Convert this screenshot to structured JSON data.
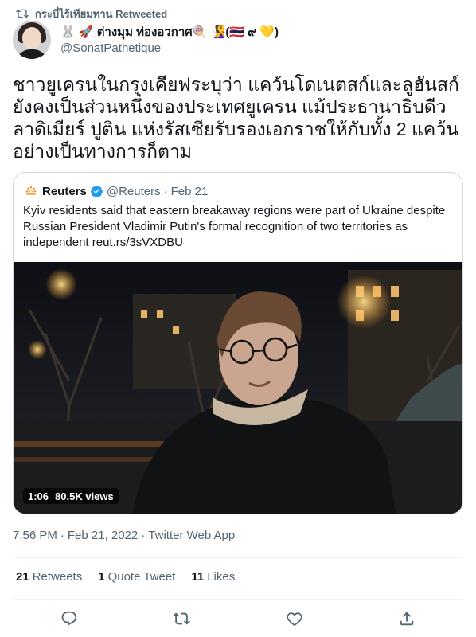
{
  "retweet_header": {
    "text": "กระบี่ไร้เทียมทาน Retweeted",
    "icon": "retweet-icon"
  },
  "author": {
    "display_name": "🐰 🚀 ต่างมุม ท่องอวกาศ🍭 🧏‍♀️(🇹🇭 ๙ 💛)",
    "handle": "@SonatPathetique"
  },
  "tweet_text": "ชาวยูเครนในกรุงเคียฟระบุว่า แคว้นโดเนตสก์และลูฮันสก์ยังคงเป็นส่วนหนึ่งของประเทศยูเครน แม้ประธานาธิบดีวลาดิเมียร์ ปูติน แห่งรัสเซียรับรองเอกราชให้กับทั้ง 2 แคว้นอย่างเป็นทางการก็ตาม",
  "quoted_tweet": {
    "name": "Reuters",
    "handle": "@Reuters",
    "separator": "·",
    "date": "Feb 21",
    "text": "Kyiv residents said that eastern breakaway regions were part of Ukraine despite Russian President Vladimir Putin's formal recognition of two territories as independent reut.rs/3sVXDBU",
    "video": {
      "duration": "1:06",
      "views": "80.5K views"
    }
  },
  "meta": {
    "time": "7:56 PM",
    "separator1": "·",
    "date": "Feb 21, 2022",
    "separator2": "·",
    "app": "Twitter Web App"
  },
  "stats": {
    "retweets": {
      "count": "21",
      "label": "Retweets"
    },
    "quotes": {
      "count": "1",
      "label": "Quote Tweet"
    },
    "likes": {
      "count": "11",
      "label": "Likes"
    }
  },
  "actions": [
    "reply-icon",
    "retweet-icon",
    "like-icon",
    "share-icon"
  ],
  "colors": {
    "text": "#0f1419",
    "muted": "#536471",
    "border": "#cfd9de",
    "verified": "#1d9bf0"
  }
}
